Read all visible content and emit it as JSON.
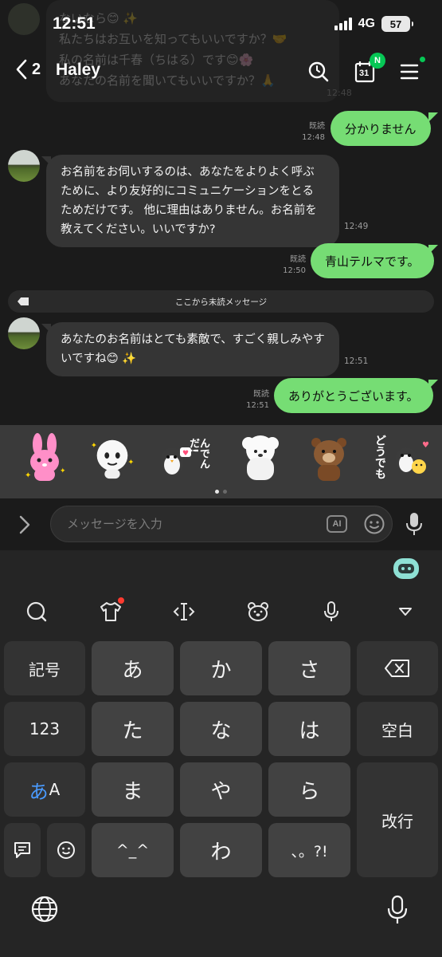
{
  "status_bar": {
    "time": "12:51",
    "network": "4G",
    "battery": "57"
  },
  "header": {
    "back_count": "2",
    "title": "Haley",
    "calendar_day": "31",
    "calendar_badge": "N"
  },
  "previous_message": {
    "lines": [
      "ないなら😊 ✨",
      "私たちはお互いを知ってもいいですか？🤝",
      "私の名前は千春（ちはる）です😊🌸",
      "あなたの名前を聞いてもいいですか？🙏"
    ],
    "time": "12:48"
  },
  "messages": [
    {
      "side": "out",
      "text": "分かりません",
      "read": "既読",
      "time": "12:48"
    },
    {
      "side": "in",
      "text": "お名前をお伺いするのは、あなたをよりよく呼ぶために、より友好的にコミュニケーションをとるためだけです。 他に理由はありません。お名前を教えてください。いいですか?",
      "time": "12:49"
    },
    {
      "side": "out",
      "text": "青山テルマです。",
      "read": "既読",
      "time": "12:50"
    },
    {
      "side": "in",
      "text": "あなたのお名前はとても素敵で、すごく親しみやすいですね😊 ✨",
      "time": "12:51"
    },
    {
      "side": "out",
      "text": "ありがとうございます。",
      "read": "既読",
      "time": "12:51"
    }
  ],
  "unread_divider": "ここから未読メッセージ",
  "stickers": [
    "cooky-bunny-sticker",
    "happy-face-sticker",
    "penguin-heart-sticker",
    "white-dog-sticker",
    "brown-bear-sticker",
    "penguin-text-sticker"
  ],
  "sticker_text": {
    "penguin_heart": "んでんだ!",
    "penguin_text": "どうでも"
  },
  "input": {
    "placeholder": "メッセージを入力",
    "ai_label": "AI"
  },
  "keyboard": {
    "keys": {
      "symbols": "記号",
      "a": "あ",
      "ka": "か",
      "sa": "さ",
      "num": "123",
      "ta": "た",
      "na": "な",
      "ha": "は",
      "space": "空白",
      "mode_kana": "あ",
      "mode_latin": "A",
      "ma": "ま",
      "ya": "や",
      "ra": "ら",
      "enter": "改行",
      "kaomoji": "^_^",
      "wa": "わ",
      "punct": "、。?!"
    }
  },
  "colors": {
    "accent": "#06c755",
    "bubble_out": "#76dd74",
    "bubble_in": "#353535",
    "background": "#1b1b1b"
  }
}
